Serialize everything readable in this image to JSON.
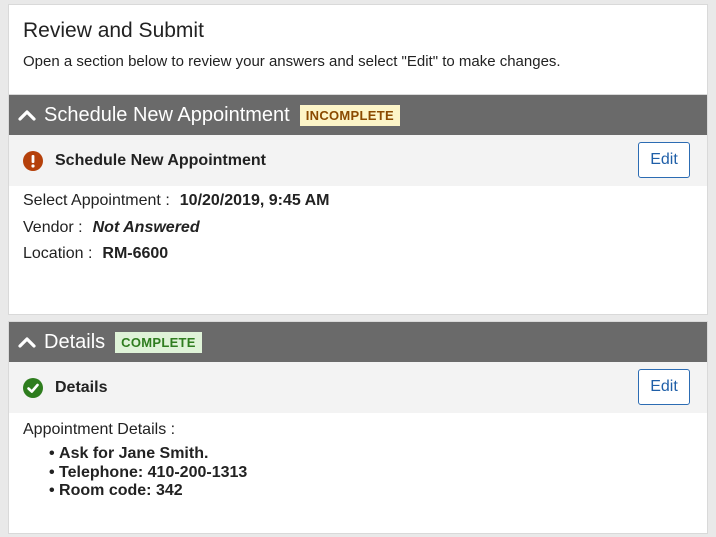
{
  "page": {
    "title": "Review and Submit",
    "subtitle": "Open a section below to review your answers and select \"Edit\" to make changes."
  },
  "sections": [
    {
      "title": "Schedule New Appointment",
      "badge": "INCOMPLETE",
      "status": "incomplete",
      "subheading": "Schedule New Appointment",
      "edit_label": "Edit",
      "fields": [
        {
          "label": "Select Appointment :",
          "value": "10/20/2019, 9:45 AM"
        },
        {
          "label": "Vendor :",
          "value": "Not Answered"
        },
        {
          "label": "Location :",
          "value": "RM-6600"
        }
      ]
    },
    {
      "title": "Details",
      "badge": "COMPLETE",
      "status": "complete",
      "subheading": "Details",
      "edit_label": "Edit",
      "details_label": "Appointment Details  :",
      "notes": [
        "Ask for Jane Smith.",
        "Telephone: 410-200-1313",
        "Room code: 342"
      ]
    }
  ],
  "colors": {
    "header_bar": "#6a6a6a",
    "incomplete_badge_bg": "#fdf5c8",
    "incomplete_badge_text": "#8a4a00",
    "complete_badge_bg": "#dff3d8",
    "complete_badge_text": "#2f7d1f",
    "warning_icon": "#b5400a",
    "check_icon": "#2e7d1e",
    "edit_button": "#2c6cb3"
  },
  "icons": {
    "collapse": "chevron-up-icon",
    "warning": "exclamation-circle-icon",
    "complete": "check-circle-icon"
  }
}
